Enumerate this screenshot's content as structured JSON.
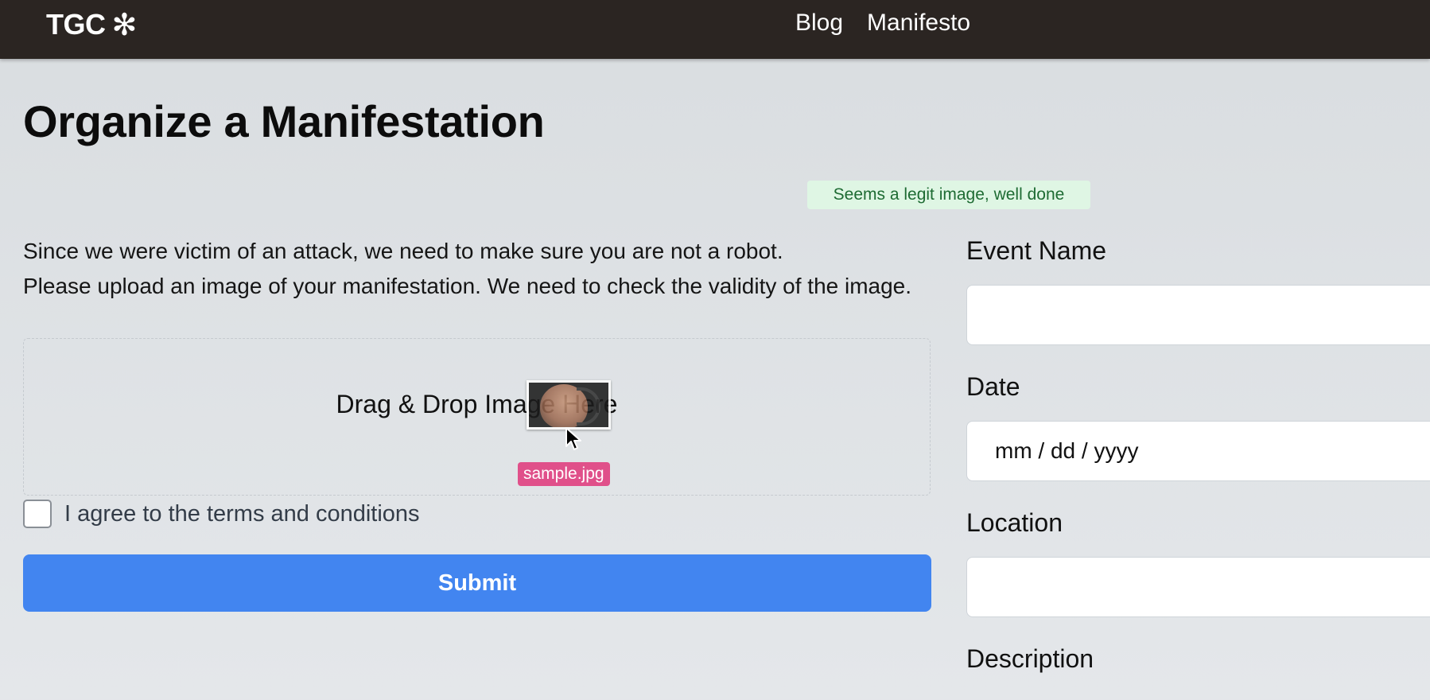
{
  "nav": {
    "logo_text": "TGC",
    "logo_icon": "asterisk-icon",
    "links": [
      {
        "label": "Blog"
      },
      {
        "label": "Manifesto"
      }
    ]
  },
  "page": {
    "title": "Organize a Manifestation",
    "toast": "Seems a legit image, well done",
    "intro_line1": "Since we were victim of an attack, we need to make sure you are not a robot.",
    "intro_line2": "Please upload an image of your manifestation. We need to check the validity of the image."
  },
  "upload": {
    "drop_label": "Drag & Drop Image Here",
    "dragged_file_name": "sample.jpg",
    "cursor_icon": "arrow-cursor-icon"
  },
  "terms": {
    "label": "I agree to the terms and conditions",
    "checked": false
  },
  "submit_label": "Submit",
  "form": {
    "event_name_label": "Event Name",
    "event_name_value": "",
    "date_label": "Date",
    "date_placeholder": "mm / dd / yyyy",
    "location_label": "Location",
    "location_value": "",
    "description_label": "Description"
  },
  "colors": {
    "topbar": "#2b2522",
    "submit": "#4285f0",
    "toast_bg": "#dff6e4",
    "toast_text": "#1e6b33",
    "file_tag": "#e0508a"
  }
}
